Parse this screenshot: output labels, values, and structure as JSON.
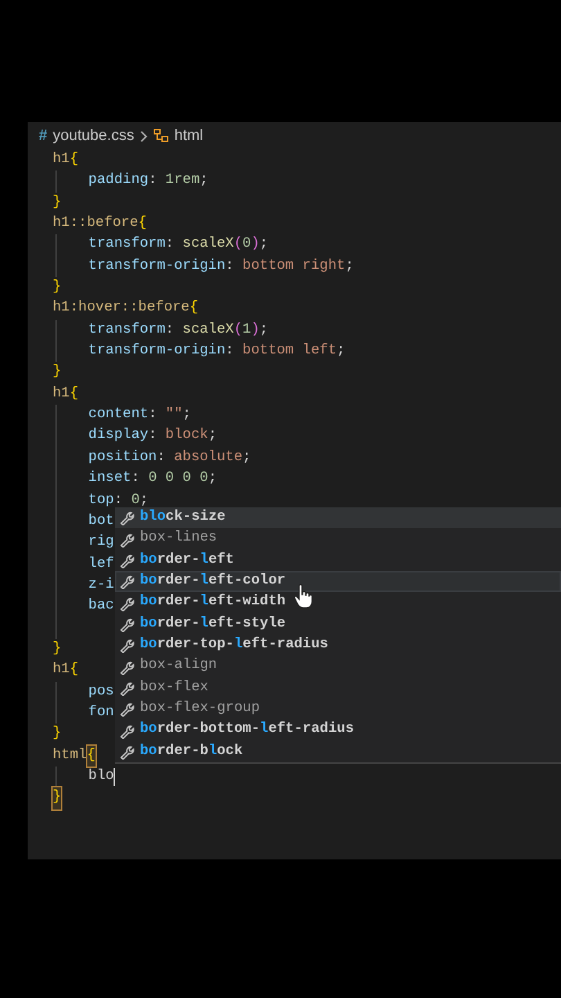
{
  "breadcrumb": {
    "icon": "#",
    "file": "youtube.css",
    "symbol": "html"
  },
  "lines": [
    {
      "indent": false,
      "tokens": [
        {
          "text": "h1",
          "kind": "selector"
        },
        {
          "text": "{",
          "kind": "brace"
        }
      ]
    },
    {
      "indent": true,
      "tokens": [
        {
          "text": "padding",
          "kind": "property"
        },
        {
          "text": ": ",
          "kind": "punct"
        },
        {
          "text": "1rem",
          "kind": "number"
        },
        {
          "text": ";",
          "kind": "punct"
        }
      ]
    },
    {
      "indent": false,
      "tokens": [
        {
          "text": "}",
          "kind": "brace"
        }
      ]
    },
    {
      "indent": false,
      "tokens": [
        {
          "text": "h1::before",
          "kind": "selector"
        },
        {
          "text": "{",
          "kind": "brace"
        }
      ]
    },
    {
      "indent": true,
      "tokens": [
        {
          "text": "transform",
          "kind": "property"
        },
        {
          "text": ": ",
          "kind": "punct"
        },
        {
          "text": "scaleX",
          "kind": "function"
        },
        {
          "text": "(",
          "kind": "paren"
        },
        {
          "text": "0",
          "kind": "number"
        },
        {
          "text": ")",
          "kind": "paren"
        },
        {
          "text": ";",
          "kind": "punct"
        }
      ]
    },
    {
      "indent": true,
      "tokens": [
        {
          "text": "transform-origin",
          "kind": "property"
        },
        {
          "text": ": ",
          "kind": "punct"
        },
        {
          "text": "bottom right",
          "kind": "value"
        },
        {
          "text": ";",
          "kind": "punct"
        }
      ]
    },
    {
      "indent": false,
      "tokens": [
        {
          "text": "}",
          "kind": "brace"
        }
      ]
    },
    {
      "indent": false,
      "tokens": [
        {
          "text": "h1:hover::before",
          "kind": "selector"
        },
        {
          "text": "{",
          "kind": "brace"
        }
      ]
    },
    {
      "indent": true,
      "tokens": [
        {
          "text": "transform",
          "kind": "property"
        },
        {
          "text": ": ",
          "kind": "punct"
        },
        {
          "text": "scaleX",
          "kind": "function"
        },
        {
          "text": "(",
          "kind": "paren"
        },
        {
          "text": "1",
          "kind": "number"
        },
        {
          "text": ")",
          "kind": "paren"
        },
        {
          "text": ";",
          "kind": "punct"
        }
      ]
    },
    {
      "indent": true,
      "tokens": [
        {
          "text": "transform-origin",
          "kind": "property"
        },
        {
          "text": ": ",
          "kind": "punct"
        },
        {
          "text": "bottom left",
          "kind": "value"
        },
        {
          "text": ";",
          "kind": "punct"
        }
      ]
    },
    {
      "indent": false,
      "tokens": [
        {
          "text": "}",
          "kind": "brace"
        }
      ]
    },
    {
      "indent": false,
      "tokens": [
        {
          "text": "h1",
          "kind": "selector"
        },
        {
          "text": "{",
          "kind": "brace"
        }
      ]
    },
    {
      "indent": true,
      "tokens": [
        {
          "text": "content",
          "kind": "property"
        },
        {
          "text": ": ",
          "kind": "punct"
        },
        {
          "text": "\"\"",
          "kind": "value"
        },
        {
          "text": ";",
          "kind": "punct"
        }
      ]
    },
    {
      "indent": true,
      "tokens": [
        {
          "text": "display",
          "kind": "property"
        },
        {
          "text": ": ",
          "kind": "punct"
        },
        {
          "text": "block",
          "kind": "value"
        },
        {
          "text": ";",
          "kind": "punct"
        }
      ]
    },
    {
      "indent": true,
      "tokens": [
        {
          "text": "position",
          "kind": "property"
        },
        {
          "text": ": ",
          "kind": "punct"
        },
        {
          "text": "absolute",
          "kind": "value"
        },
        {
          "text": ";",
          "kind": "punct"
        }
      ]
    },
    {
      "indent": true,
      "tokens": [
        {
          "text": "inset",
          "kind": "property"
        },
        {
          "text": ": ",
          "kind": "punct"
        },
        {
          "text": "0 0 0 0",
          "kind": "number"
        },
        {
          "text": ";",
          "kind": "punct"
        }
      ]
    },
    {
      "indent": true,
      "tokens": [
        {
          "text": "top",
          "kind": "property"
        },
        {
          "text": ": ",
          "kind": "punct"
        },
        {
          "text": "0",
          "kind": "number"
        },
        {
          "text": ";",
          "kind": "punct"
        }
      ]
    },
    {
      "indent": true,
      "tokens": [
        {
          "text": "bot",
          "kind": "property"
        }
      ]
    },
    {
      "indent": true,
      "tokens": [
        {
          "text": "rig",
          "kind": "property"
        }
      ]
    },
    {
      "indent": true,
      "tokens": [
        {
          "text": "lef",
          "kind": "property"
        }
      ]
    },
    {
      "indent": true,
      "tokens": [
        {
          "text": "z-i",
          "kind": "property"
        }
      ]
    },
    {
      "indent": true,
      "tokens": [
        {
          "text": "bac",
          "kind": "property"
        }
      ]
    },
    {
      "indent": true
    },
    {
      "indent": false,
      "tokens": [
        {
          "text": "}",
          "kind": "brace"
        }
      ]
    },
    {
      "indent": false,
      "tokens": [
        {
          "text": "h1",
          "kind": "selector"
        },
        {
          "text": "{",
          "kind": "brace"
        }
      ]
    },
    {
      "indent": true,
      "tokens": [
        {
          "text": "pos",
          "kind": "property"
        }
      ]
    },
    {
      "indent": true,
      "tokens": [
        {
          "text": "fon",
          "kind": "property"
        }
      ]
    },
    {
      "indent": false,
      "tokens": [
        {
          "text": "}",
          "kind": "brace"
        }
      ]
    },
    {
      "indent": false,
      "tokens": [
        {
          "text": "html",
          "kind": "selector"
        },
        {
          "text": "{",
          "kind": "match"
        }
      ]
    },
    {
      "indent": true,
      "tokens": [
        {
          "text": "blo",
          "kind": "typed"
        }
      ]
    },
    {
      "indent": false,
      "tokens": [
        {
          "text": "}",
          "kind": "match"
        }
      ]
    }
  ],
  "suggestions": [
    {
      "selected": true,
      "hovered": false,
      "deprecated": false,
      "parts": [
        {
          "text": "blo",
          "match": true
        },
        {
          "text": "ck-size",
          "match": false
        }
      ]
    },
    {
      "selected": false,
      "hovered": false,
      "deprecated": true,
      "parts": [
        {
          "text": "box-lines",
          "match": false
        }
      ]
    },
    {
      "selected": false,
      "hovered": false,
      "deprecated": false,
      "parts": [
        {
          "text": "bo",
          "match": true
        },
        {
          "text": "rder-",
          "match": false
        },
        {
          "text": "l",
          "match": true
        },
        {
          "text": "eft",
          "match": false
        }
      ]
    },
    {
      "selected": false,
      "hovered": true,
      "deprecated": false,
      "parts": [
        {
          "text": "bo",
          "match": true
        },
        {
          "text": "rder-",
          "match": false
        },
        {
          "text": "l",
          "match": true
        },
        {
          "text": "eft-color",
          "match": false
        }
      ]
    },
    {
      "selected": false,
      "hovered": false,
      "deprecated": false,
      "parts": [
        {
          "text": "bo",
          "match": true
        },
        {
          "text": "rder-",
          "match": false
        },
        {
          "text": "l",
          "match": true
        },
        {
          "text": "eft-width",
          "match": false
        }
      ]
    },
    {
      "selected": false,
      "hovered": false,
      "deprecated": false,
      "parts": [
        {
          "text": "bo",
          "match": true
        },
        {
          "text": "rder-",
          "match": false
        },
        {
          "text": "l",
          "match": true
        },
        {
          "text": "eft-style",
          "match": false
        }
      ]
    },
    {
      "selected": false,
      "hovered": false,
      "deprecated": false,
      "parts": [
        {
          "text": "bo",
          "match": true
        },
        {
          "text": "rder-top-",
          "match": false
        },
        {
          "text": "l",
          "match": true
        },
        {
          "text": "eft-radius",
          "match": false
        }
      ]
    },
    {
      "selected": false,
      "hovered": false,
      "deprecated": true,
      "parts": [
        {
          "text": "box-align",
          "match": false
        }
      ]
    },
    {
      "selected": false,
      "hovered": false,
      "deprecated": true,
      "parts": [
        {
          "text": "box-flex",
          "match": false
        }
      ]
    },
    {
      "selected": false,
      "hovered": false,
      "deprecated": true,
      "parts": [
        {
          "text": "box-flex-group",
          "match": false
        }
      ]
    },
    {
      "selected": false,
      "hovered": false,
      "deprecated": false,
      "parts": [
        {
          "text": "bo",
          "match": true
        },
        {
          "text": "rder-bottom-",
          "match": false
        },
        {
          "text": "l",
          "match": true
        },
        {
          "text": "eft-radius",
          "match": false
        }
      ]
    },
    {
      "selected": false,
      "hovered": false,
      "deprecated": false,
      "parts": [
        {
          "text": "bo",
          "match": true
        },
        {
          "text": "rder-b",
          "match": false
        },
        {
          "text": "l",
          "match": true
        },
        {
          "text": "ock",
          "match": false
        }
      ]
    }
  ]
}
